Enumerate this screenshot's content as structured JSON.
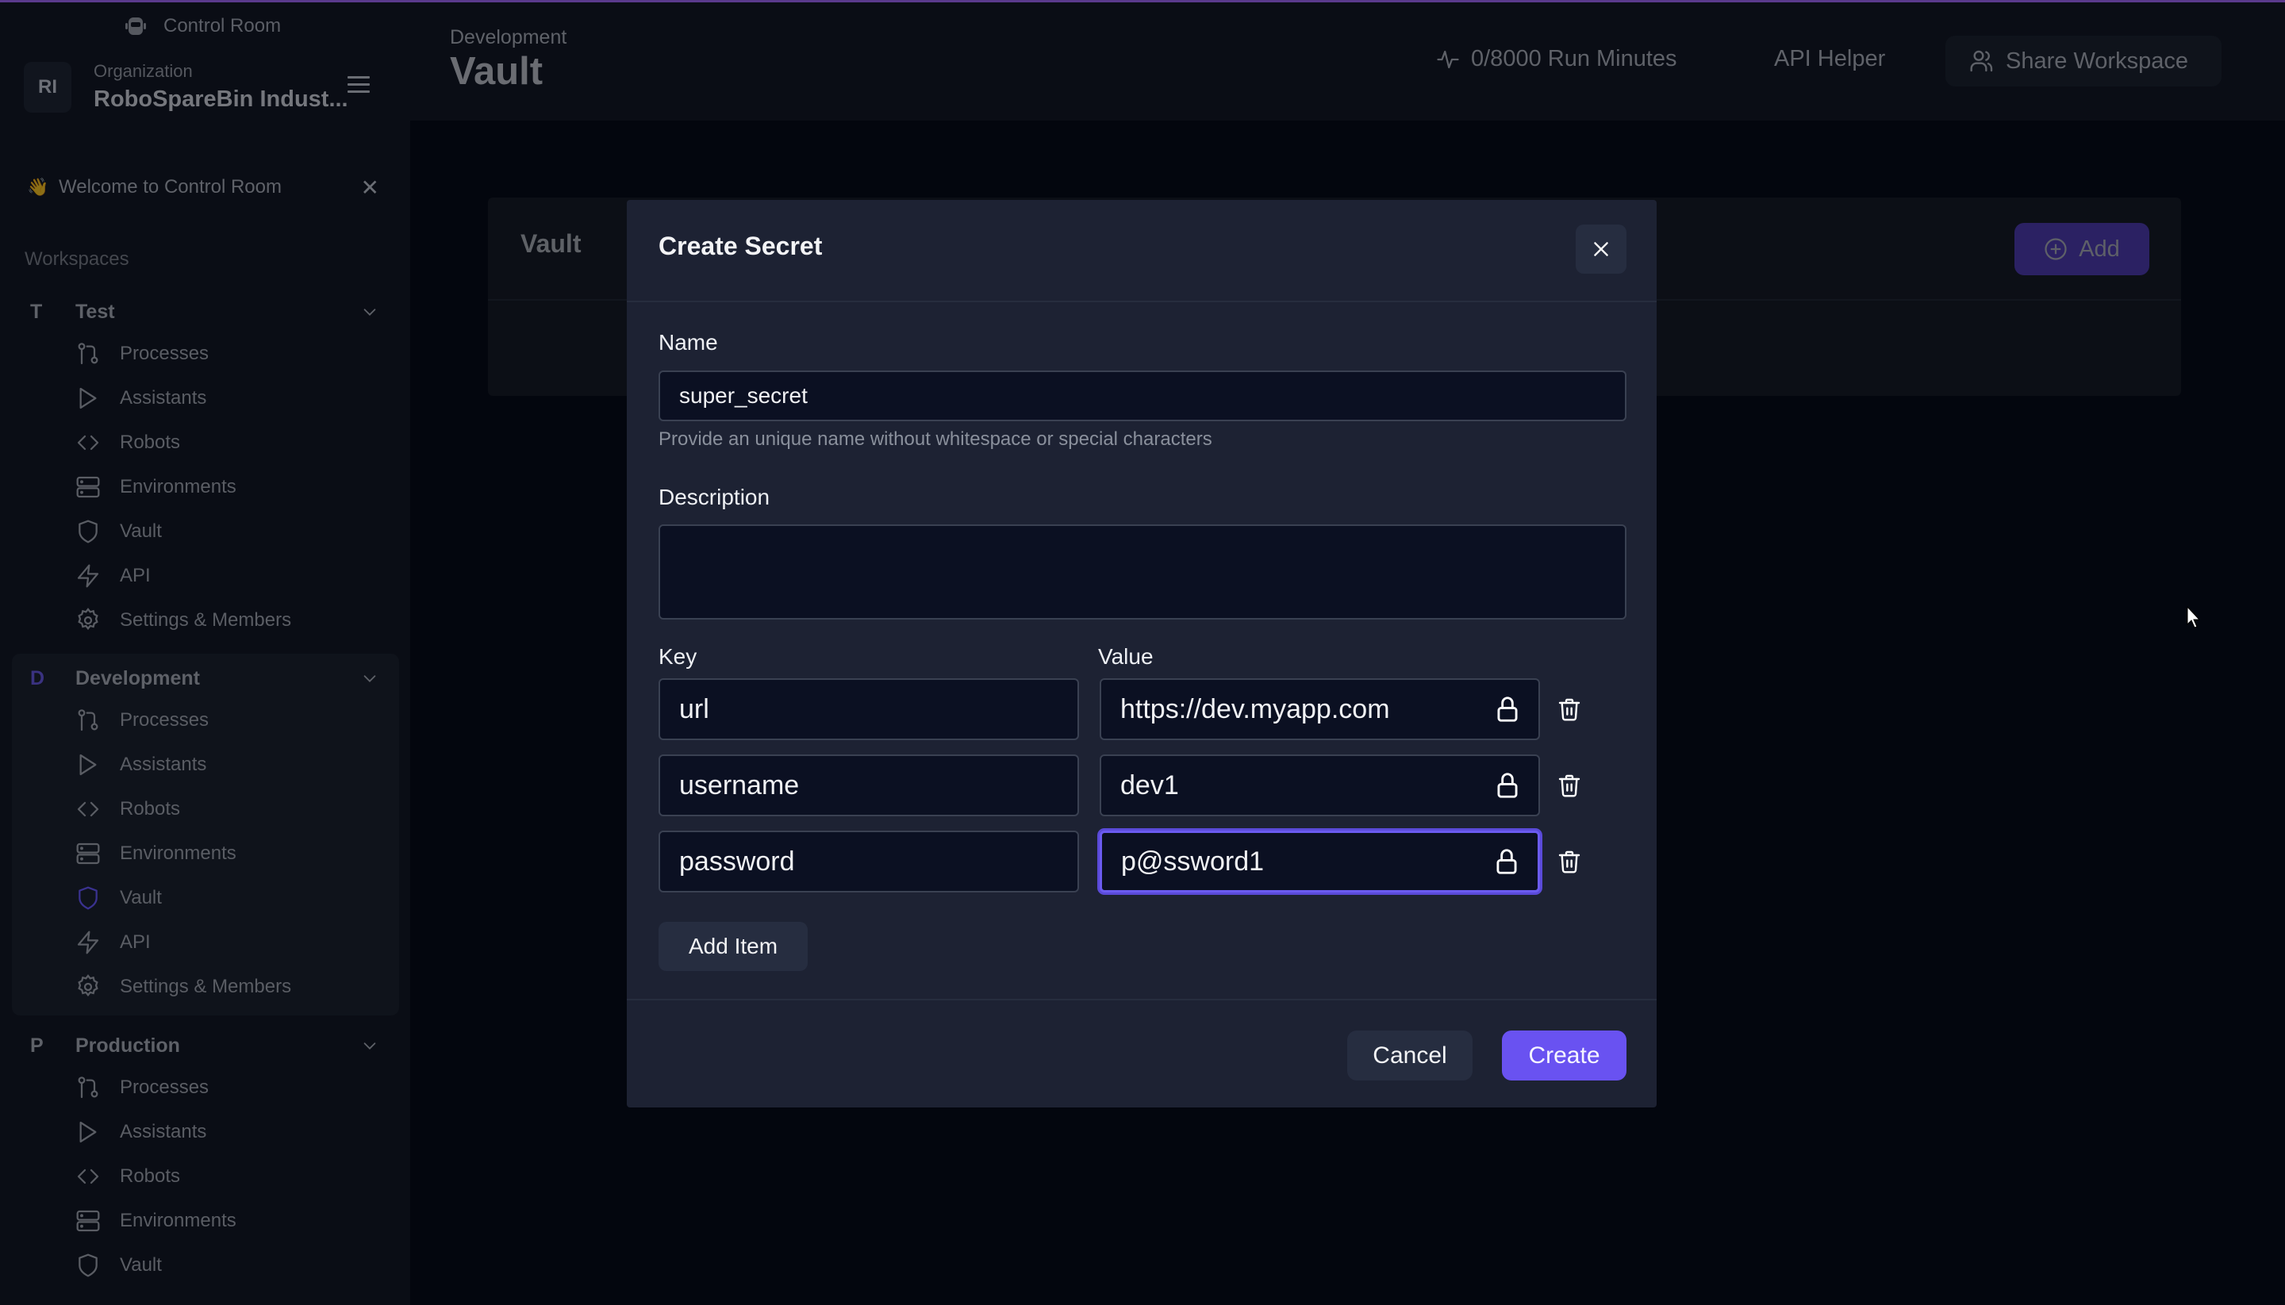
{
  "app": {
    "brand": "Control Room"
  },
  "org": {
    "initials": "RI",
    "label": "Organization",
    "name": "RoboSpareBin Indust..."
  },
  "welcome": {
    "emoji": "👋",
    "text": "Welcome to Control Room"
  },
  "workspaces_title": "Workspaces",
  "workspaces": [
    {
      "initial": "T",
      "name": "Test",
      "items": [
        "Processes",
        "Assistants",
        "Robots",
        "Environments",
        "Vault",
        "API",
        "Settings & Members"
      ]
    },
    {
      "initial": "D",
      "name": "Development",
      "items": [
        "Processes",
        "Assistants",
        "Robots",
        "Environments",
        "Vault",
        "API",
        "Settings & Members"
      ],
      "active_item": "Vault"
    },
    {
      "initial": "P",
      "name": "Production",
      "items": [
        "Processes",
        "Assistants",
        "Robots",
        "Environments",
        "Vault"
      ]
    }
  ],
  "header": {
    "breadcrumb": "Development",
    "title": "Vault",
    "run_minutes": "0/8000 Run Minutes",
    "api_helper": "API Helper",
    "share_workspace": "Share Workspace"
  },
  "vault_card": {
    "title": "Vault",
    "add_label": "Add"
  },
  "modal": {
    "title": "Create Secret",
    "name_label": "Name",
    "name_value": "super_secret",
    "name_hint": "Provide an unique name without whitespace or special characters",
    "description_label": "Description",
    "description_value": "",
    "key_label": "Key",
    "value_label": "Value",
    "items": [
      {
        "key": "url",
        "value": "https://dev.myapp.com"
      },
      {
        "key": "username",
        "value": "dev1"
      },
      {
        "key": "password",
        "value": "p@ssword1"
      }
    ],
    "add_item_label": "Add Item",
    "cancel_label": "Cancel",
    "create_label": "Create"
  },
  "colors": {
    "accent": "#6952f1",
    "modal_bg": "#1d2233",
    "input_bg": "#0b1022",
    "page_bg": "#03060e"
  }
}
